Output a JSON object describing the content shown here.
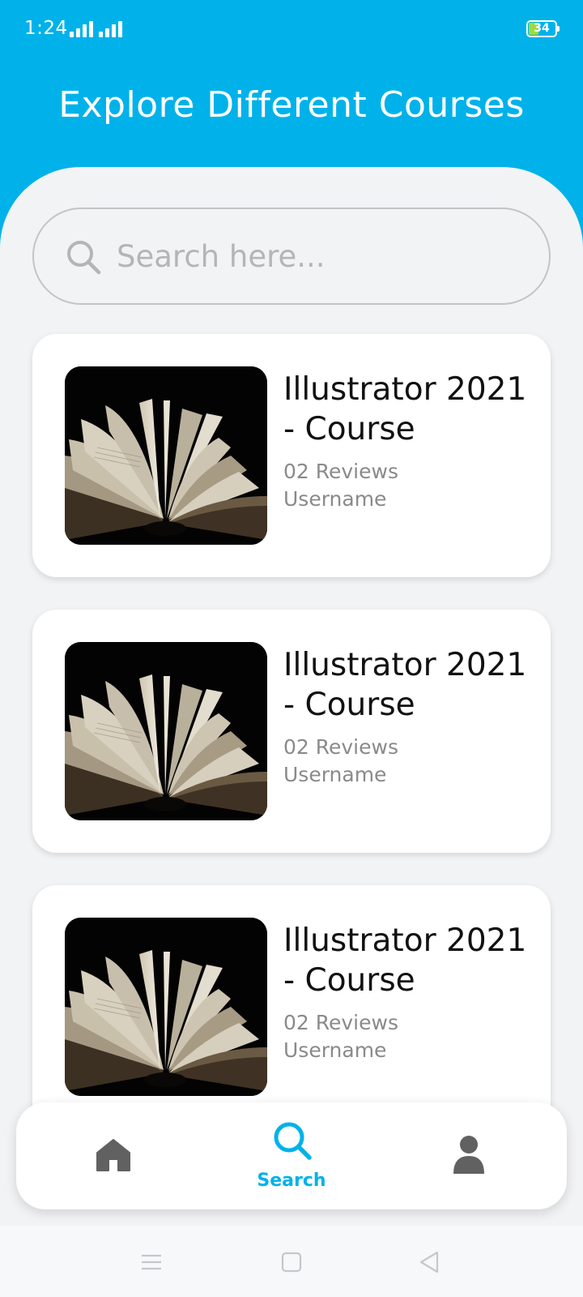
{
  "colors": {
    "header_bg": "#00b2e9",
    "accent": "#00b2e9",
    "page_bg": "#f2f3f5",
    "card_bg": "#ffffff",
    "nav_inactive": "#616161"
  },
  "status_bar": {
    "time": "1:24",
    "battery": "34",
    "icons": [
      "signal-icon",
      "signal-icon",
      "battery-icon"
    ]
  },
  "header": {
    "title": "Explore Different Courses"
  },
  "search": {
    "placeholder": "Search here...",
    "value": "",
    "icon": "search-icon"
  },
  "courses": [
    {
      "title_line1": "Illustrator 2021",
      "title_line2": "- Course",
      "reviews": "02 Reviews",
      "author": "Username",
      "thumbnail": "open-book-image"
    },
    {
      "title_line1": "Illustrator 2021",
      "title_line2": "- Course",
      "reviews": "02 Reviews",
      "author": "Username",
      "thumbnail": "open-book-image"
    },
    {
      "title_line1": "Illustrator 2021",
      "title_line2": "- Course",
      "reviews": "02 Reviews",
      "author": "Username",
      "thumbnail": "open-book-image"
    }
  ],
  "bottom_nav": {
    "items": [
      {
        "icon": "home-icon",
        "label": "",
        "active": false
      },
      {
        "icon": "search-icon",
        "label": "Search",
        "active": true
      },
      {
        "icon": "person-icon",
        "label": "",
        "active": false
      }
    ]
  },
  "system_nav": {
    "icons": [
      "menu-icon",
      "square-home-icon",
      "back-triangle-icon"
    ]
  }
}
